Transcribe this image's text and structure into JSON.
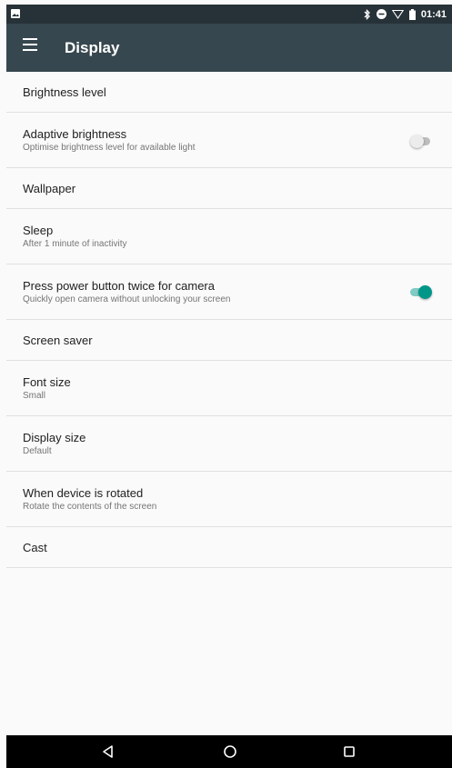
{
  "status_bar": {
    "time": "01:41",
    "icons": [
      "image-notification-icon",
      "bluetooth-icon",
      "do-not-disturb-icon",
      "wifi-icon",
      "battery-icon"
    ]
  },
  "app_bar": {
    "title": "Display",
    "menu_icon": "hamburger-menu-icon"
  },
  "settings": [
    {
      "title": "Brightness level"
    },
    {
      "title": "Adaptive brightness",
      "summary": "Optimise brightness level for available light",
      "toggle": "off"
    },
    {
      "title": "Wallpaper"
    },
    {
      "title": "Sleep",
      "summary": "After 1 minute of inactivity"
    },
    {
      "title": "Press power button twice for camera",
      "summary": "Quickly open camera without unlocking your screen",
      "toggle": "on"
    },
    {
      "title": "Screen saver"
    },
    {
      "title": "Font size",
      "summary": "Small"
    },
    {
      "title": "Display size",
      "summary": "Default"
    },
    {
      "title": "When device is rotated",
      "summary": "Rotate the contents of the screen"
    },
    {
      "title": "Cast"
    }
  ],
  "nav_bar": {
    "buttons": [
      "back-icon",
      "home-icon",
      "recents-icon"
    ]
  },
  "colors": {
    "status_bar": "#263238",
    "app_bar": "#37474f",
    "background": "#fafafa",
    "accent": "#009688",
    "switch_off": "#bdbdbd",
    "divider": "#e0e0e0"
  }
}
